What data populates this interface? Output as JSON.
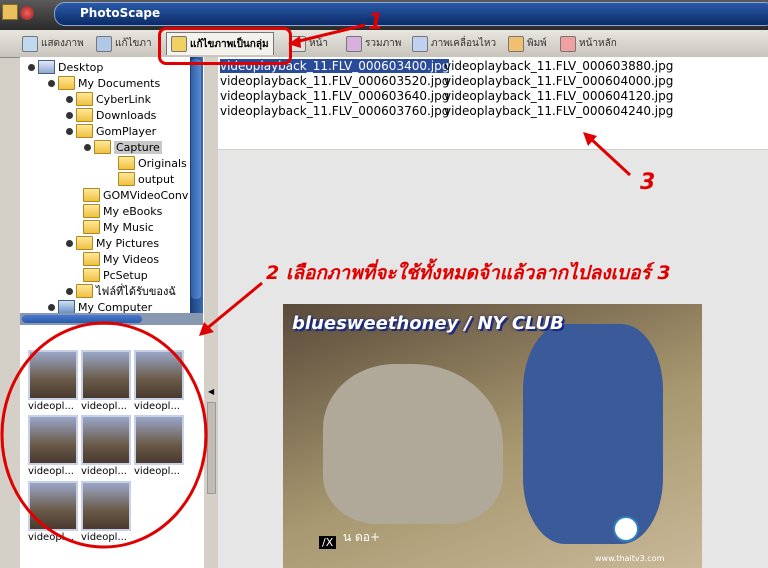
{
  "app": {
    "title": "PhotoScape"
  },
  "tabs": [
    {
      "label": "แสดงภาพ",
      "icon": "viewer-icon"
    },
    {
      "label": "แก้ไขภา",
      "icon": "editor-icon"
    },
    {
      "label": "แก้ไขภาพเป็นกลุ่ม",
      "icon": "batch-editor-icon"
    },
    {
      "label": "หน้า",
      "icon": "page-icon"
    },
    {
      "label": "รวมภาพ",
      "icon": "combine-icon"
    },
    {
      "label": "ภาพเคลื่อนไหว",
      "icon": "animated-gif-icon"
    },
    {
      "label": "พิมพ์",
      "icon": "print-icon"
    },
    {
      "label": "หน้าหลัก",
      "icon": "home-icon"
    }
  ],
  "tree": [
    {
      "label": "Desktop",
      "icon": "desktop-icon"
    },
    {
      "label": "My Documents",
      "icon": "folder-icon"
    },
    {
      "label": "CyberLink",
      "icon": "folder-icon"
    },
    {
      "label": "Downloads",
      "icon": "folder-icon"
    },
    {
      "label": "GomPlayer",
      "icon": "folder-icon"
    },
    {
      "label": "Capture",
      "icon": "folder-icon"
    },
    {
      "label": "Originals",
      "icon": "folder-icon"
    },
    {
      "label": "output",
      "icon": "folder-icon"
    },
    {
      "label": "GOMVideoConv",
      "icon": "folder-icon"
    },
    {
      "label": "My eBooks",
      "icon": "folder-icon"
    },
    {
      "label": "My Music",
      "icon": "folder-icon"
    },
    {
      "label": "My Pictures",
      "icon": "folder-icon"
    },
    {
      "label": "My Videos",
      "icon": "folder-icon"
    },
    {
      "label": "PcSetup",
      "icon": "folder-icon"
    },
    {
      "label": "ไฟล์ที่ได้รับของฉั",
      "icon": "folder-icon"
    },
    {
      "label": "My Computer",
      "icon": "computer-icon"
    }
  ],
  "thumbnails": [
    "videopl...",
    "videopl...",
    "videopl...",
    "videopl...",
    "videopl...",
    "videopl...",
    "videopl...",
    "videopl..."
  ],
  "files": [
    "videoplayback_11.FLV_000603400.jpg",
    "videoplayback_11.FLV_000603880.jpg",
    "videoplayback_11.FLV_000603520.jpg",
    "videoplayback_11.FLV_000604000.jpg",
    "videoplayback_11.FLV_000603640.jpg",
    "videoplayback_11.FLV_000604120.jpg",
    "videoplayback_11.FLV_000603760.jpg",
    "videoplayback_11.FLV_000604240.jpg"
  ],
  "preview": {
    "watermark": "bluesweethoney / NY CLUB",
    "channel_tag": "/X",
    "channel_text": "น ดอ+",
    "website": "www.thaitv3.com"
  },
  "annotations": {
    "step1": "1",
    "step2": "2 เลือกภาพที่จะใช้ทั้งหมดจ้าแล้วลากไปลงเบอร์ 3",
    "step3": "3",
    "color": "#e00000"
  }
}
